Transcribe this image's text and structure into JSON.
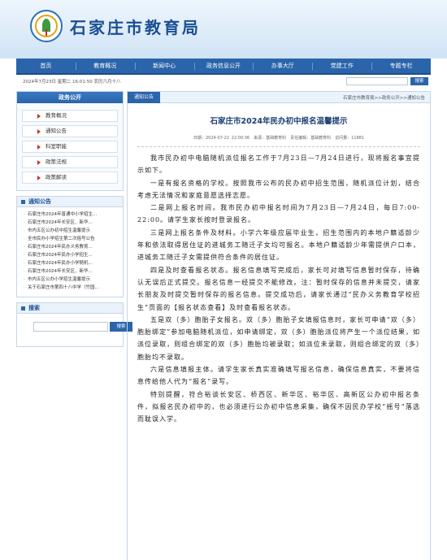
{
  "site": {
    "name": "石家庄市教育局"
  },
  "nav": [
    "首页",
    "教育概况",
    "新闻中心",
    "政务信息公开",
    "办事大厅",
    "党建工作",
    "专题专栏"
  ],
  "infobar": {
    "date": "2024年7月23日 星期二 16:01:50 农历六月十八",
    "search_button": "搜索"
  },
  "sidebar": {
    "gov_open": {
      "title": "政务公开",
      "items": [
        "教育概况",
        "通知公告",
        "科室职能",
        "政策法规",
        "政策解读"
      ]
    },
    "notices": {
      "title": "通知公告",
      "items": [
        "石家庄市2024年普通中小学招生...",
        "石家庄市2024年长安区、新华...",
        "市内五区公办初中招生温馨提示",
        "全市民办小学招生第二次摇号公告",
        "石家庄市2024年民办义务教育...",
        "石家庄市2024年民办小学招生...",
        "石家庄市2024年民办小学随机...",
        "石家庄市2024年长安区、新华...",
        "市内五区公办小学招生温馨提示",
        "关于石家庄市第四十八中学（竹园..."
      ]
    },
    "search": {
      "title": "搜索",
      "button": "搜索"
    }
  },
  "main": {
    "tab": "通知公告",
    "breadcrumb": "石家庄市教育局>>政务公开>>通知公告",
    "title": "石家庄市2024年民办初中报名温馨提示",
    "meta": "日期：2024-07-22 22:00:36　来源：基础教育科　责任编辑：基础教育科　访问量：11881",
    "paragraphs": [
      {
        "text": "我市民办初中电脑随机派位报名工作于7月23日—7月24日进行，现将报名事宜提示如下。",
        "bold": false
      },
      {
        "text": "一是有报名资格的学校。按照我市公布的民办初中招生范围，随机派位计划，结合考虑无法情况和家庭意愿选择志愿。",
        "bold": false
      },
      {
        "text": "二是网上报名时间。我市民办初中报名时间为7月23日—7月24日，每日7:00-22:00。请学生家长按时登录报名。",
        "bold": false
      },
      {
        "text": "三是网上报名条件及材料。小学六年级应届毕业生，招生范围内的本地户籍适龄少年和依法取得居住证的进城务工随迁子女均可报名。本地户籍适龄少年需提供户口本，进城务工随迁子女需提供符合条件的居住证。",
        "bold": false
      },
      {
        "text": "四是及时查看报名状态。报名信息填写完成后，家长可对填写信息暂时保存，待确认无误后正式提交。报名信息一经提交不能修改。注：暂时保存的信息并未提交，请家长朋友及时提交暂时保存的报名信息。提交成功后，请家长通过“民办义务教育学校招生”页面的【报名状态查看】及时查看报名状态。",
        "bold": false
      },
      {
        "text": "五是双（多）胞胎子女报名。双（多）胞胎子女填报信息时，家长可申请“双（多）胞胎绑定”参加电脑随机派位，如申请绑定，双（多）胞胎派位将产生一个派位结果，如派位录取，则组合绑定的双（多）胞胎均被录取；如派位未录取，则组合绑定的双（多）胞胎均不录取。",
        "bold": false
      },
      {
        "text": "六是信息填报主体。请学生家长真实准确填写报名信息，确保信息真实，不要将信息传给他人代为“报名”录写。",
        "bold": false
      },
      {
        "text": "特别提醒，符合裕谈长安区、桥西区、新华区、裕华区、高新区公办初中报名条件，拟报名民办初中的，也必须进行公办初中信息采集，确保不因民办学校“摇号”落选而耽误入学。",
        "bold": false
      }
    ]
  }
}
